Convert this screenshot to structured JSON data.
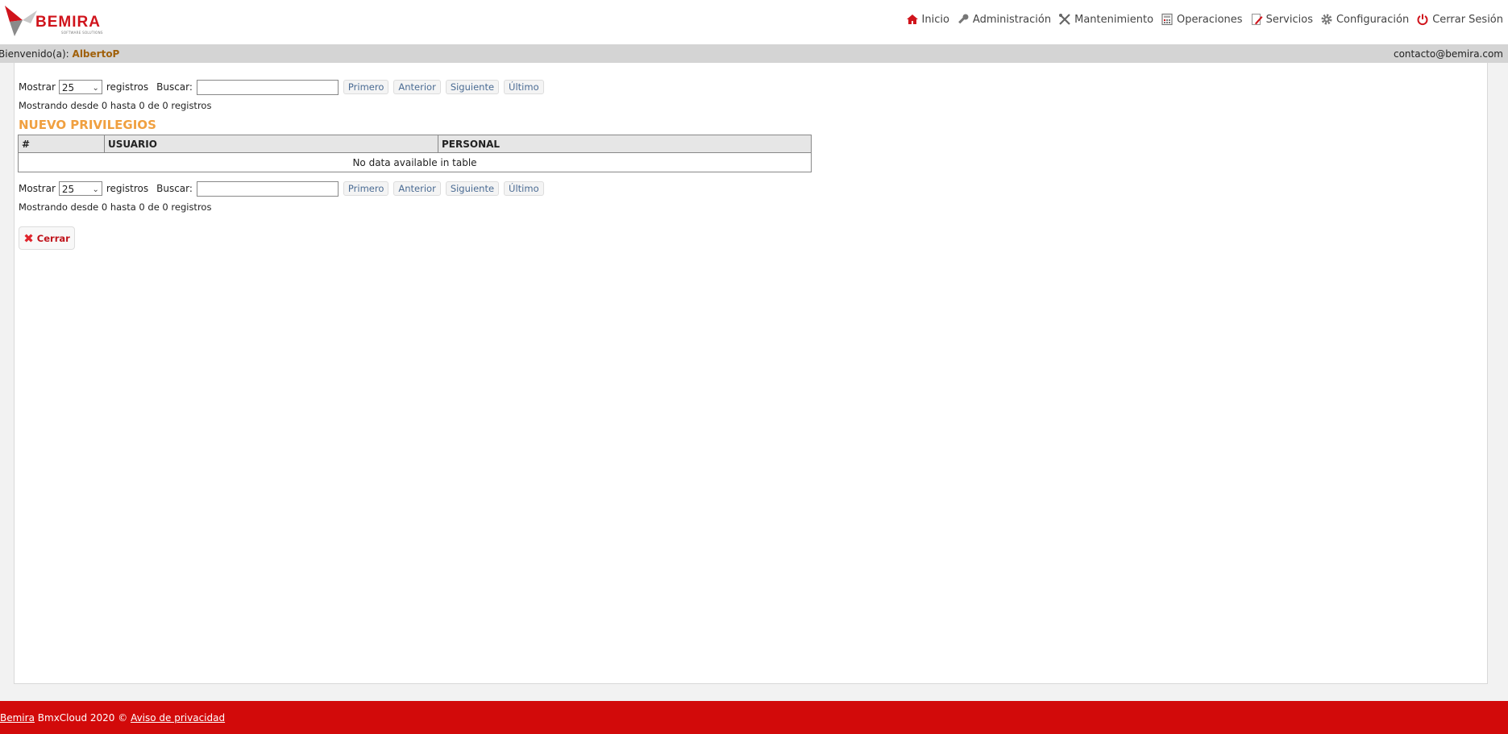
{
  "header": {
    "logo": {
      "text": "BEMIRA",
      "tagline": "SOFTWARE SOLUTIONS"
    },
    "nav": [
      {
        "label": "Inicio",
        "icon": "home-icon"
      },
      {
        "label": "Administración",
        "icon": "key-icon"
      },
      {
        "label": "Mantenimiento",
        "icon": "tools-icon"
      },
      {
        "label": "Operaciones",
        "icon": "calculator-icon"
      },
      {
        "label": "Servicios",
        "icon": "edit-icon"
      },
      {
        "label": "Configuración",
        "icon": "gear-icon"
      },
      {
        "label": "Cerrar Sesión",
        "icon": "power-icon"
      }
    ]
  },
  "welcome": {
    "prefix": "Bienvenido(a):",
    "user": "AlbertoP",
    "contact": "contacto@bemira.com"
  },
  "table_controls": {
    "show_label": "Mostrar",
    "page_size": "25",
    "records_label": "registros",
    "search_label": "Buscar:",
    "search_value": "",
    "first": "Primero",
    "previous": "Anterior",
    "next": "Siguiente",
    "last": "Último",
    "info": "Mostrando desde 0 hasta 0 de 0 registros"
  },
  "section_title": "NUEVO PRIVILEGIOS",
  "table": {
    "columns": [
      "#",
      "USUARIO",
      "PERSONAL"
    ],
    "empty_message": "No data available in table"
  },
  "close_button": "Cerrar",
  "footer": {
    "link1": "Bemira",
    "text": "BmxCloud 2020 ©",
    "link2": "Aviso de privacidad"
  },
  "colors": {
    "brand_red": "#d20a0a",
    "section_title": "#f0a040",
    "username": "#a0600a",
    "pager_text": "#4a6b93"
  }
}
